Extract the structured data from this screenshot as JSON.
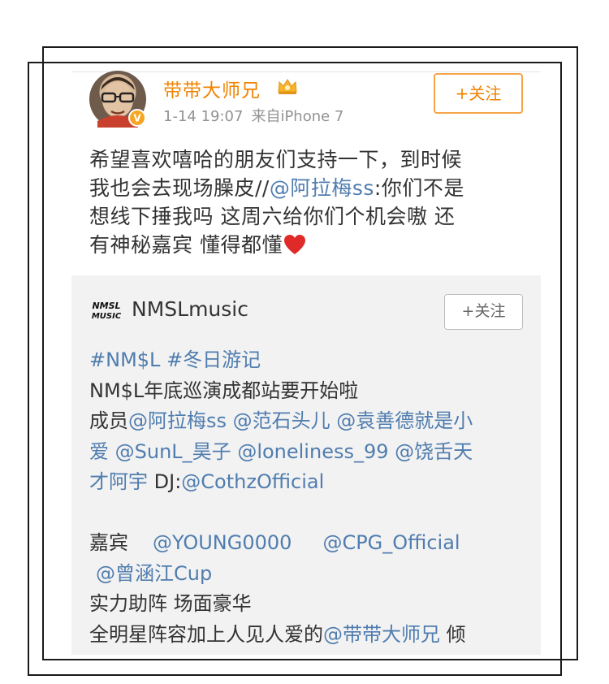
{
  "post": {
    "author": "带带大师兄",
    "time": "1-14 19:07",
    "source": "来自iPhone 7",
    "follow_label": "+关注",
    "text": {
      "l1": "希望喜欢嘻哈的朋友们支持一下，到时候",
      "l2a": "我也会去现场臊皮//",
      "l2m": "@阿拉梅ss",
      "l2b": ":你们不是",
      "l3": "想线下捶我吗 这周六给你们个机会嗷 还",
      "l4": "有神秘嘉宾 懂得都懂"
    }
  },
  "repost": {
    "author": "NMSLmusic",
    "logo_text": "NMSL MUSIC",
    "follow_label": "+关注",
    "lines": {
      "t1": "#NM$L",
      "t2": "#冬日游记",
      "l2": "NM$L年底巡演成都站要开始啦",
      "l3a": "成员",
      "l3b": "@阿拉梅ss",
      "l3c": "@范石头儿",
      "l3d": "@袁善德就是小",
      "l4a": "爱",
      "l4b": "@SunL_昊子",
      "l4c": "@loneliness_99",
      "l4d": "@饶舌天",
      "l5a": "才阿宇",
      "l5b": " DJ:",
      "l5c": "@CothzOfficial",
      "l6a": "嘉宾",
      "l6b": "@YOUNG0000",
      "l6c": "@CPG_Official",
      "l7": "@曾涵江Cup",
      "l8": "实力助阵 场面豪华",
      "l9a": "全明星阵容加上人见人爱的",
      "l9b": "@带带大师兄",
      "l9c": " 倾"
    }
  },
  "icons": {
    "verified": "verified-badge-icon",
    "vip": "crown-vip-icon",
    "emoji": "red-heart-icon"
  },
  "colors": {
    "username": "#f08300",
    "link": "#507daf",
    "text": "#333333",
    "meta": "#929292",
    "repost_bg": "#f2f2f2"
  }
}
